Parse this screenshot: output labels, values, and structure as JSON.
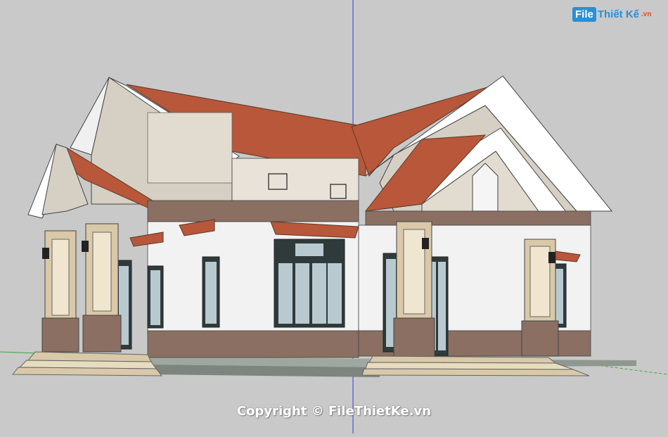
{
  "watermark": {
    "copyright": "Copyright © FileThietKe.vn",
    "logo_badge": "File",
    "logo_text": "Thiết Kế",
    "logo_tld": ".vn"
  },
  "colors": {
    "background": "#c9c9c9",
    "roof": "#b8573a",
    "wall": "#f2f2f2",
    "gable": "#d6cfc4",
    "stone": "#8a6f62",
    "column": "#d9c9a8",
    "axis_blue": "#3a3ad6",
    "axis_green": "#3aa53a",
    "brand_blue": "#2a8fd6",
    "brand_red": "#e04a2a"
  }
}
